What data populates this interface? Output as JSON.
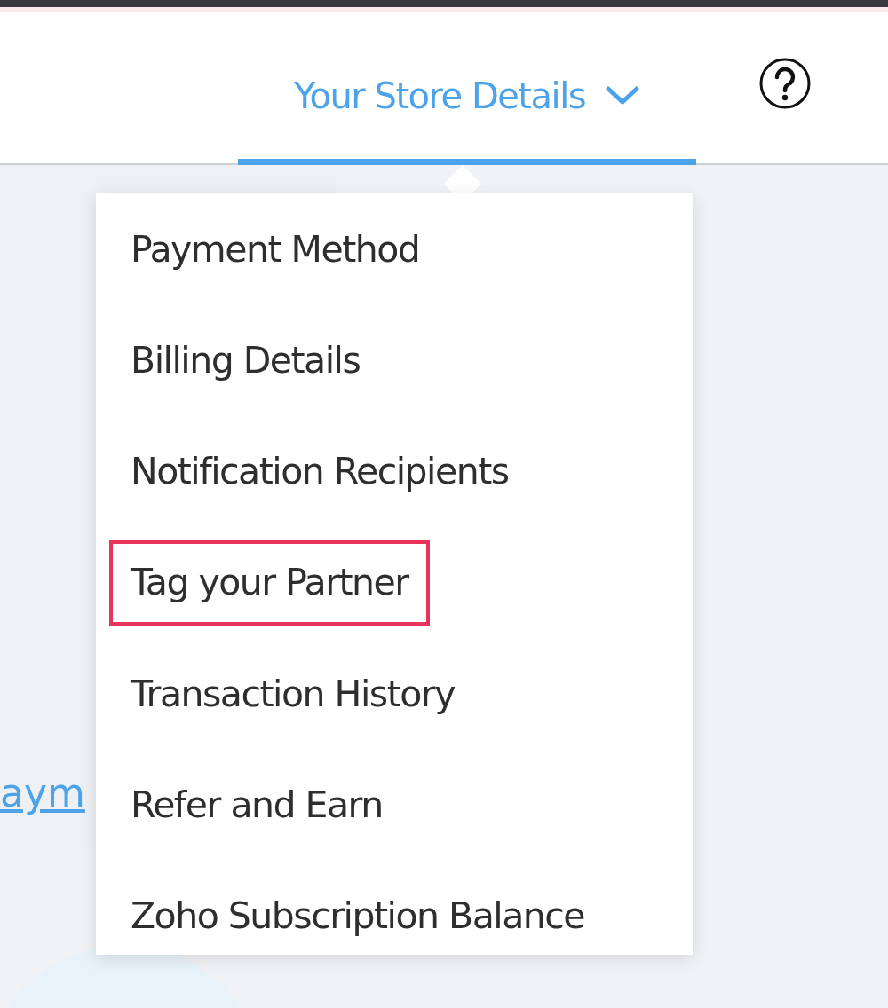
{
  "header": {
    "tab": {
      "label": "Your Store Details",
      "selected": true
    }
  },
  "background_link": {
    "text": "aym"
  },
  "menu": {
    "items": [
      {
        "label": "Payment Method",
        "highlighted": false
      },
      {
        "label": "Billing Details",
        "highlighted": false
      },
      {
        "label": "Notification Recipients",
        "highlighted": false
      },
      {
        "label": "Tag your Partner",
        "highlighted": true
      },
      {
        "label": "Transaction History",
        "highlighted": false
      },
      {
        "label": "Refer and Earn",
        "highlighted": false
      },
      {
        "label": "Zoho Subscription Balance",
        "highlighted": false
      }
    ]
  }
}
